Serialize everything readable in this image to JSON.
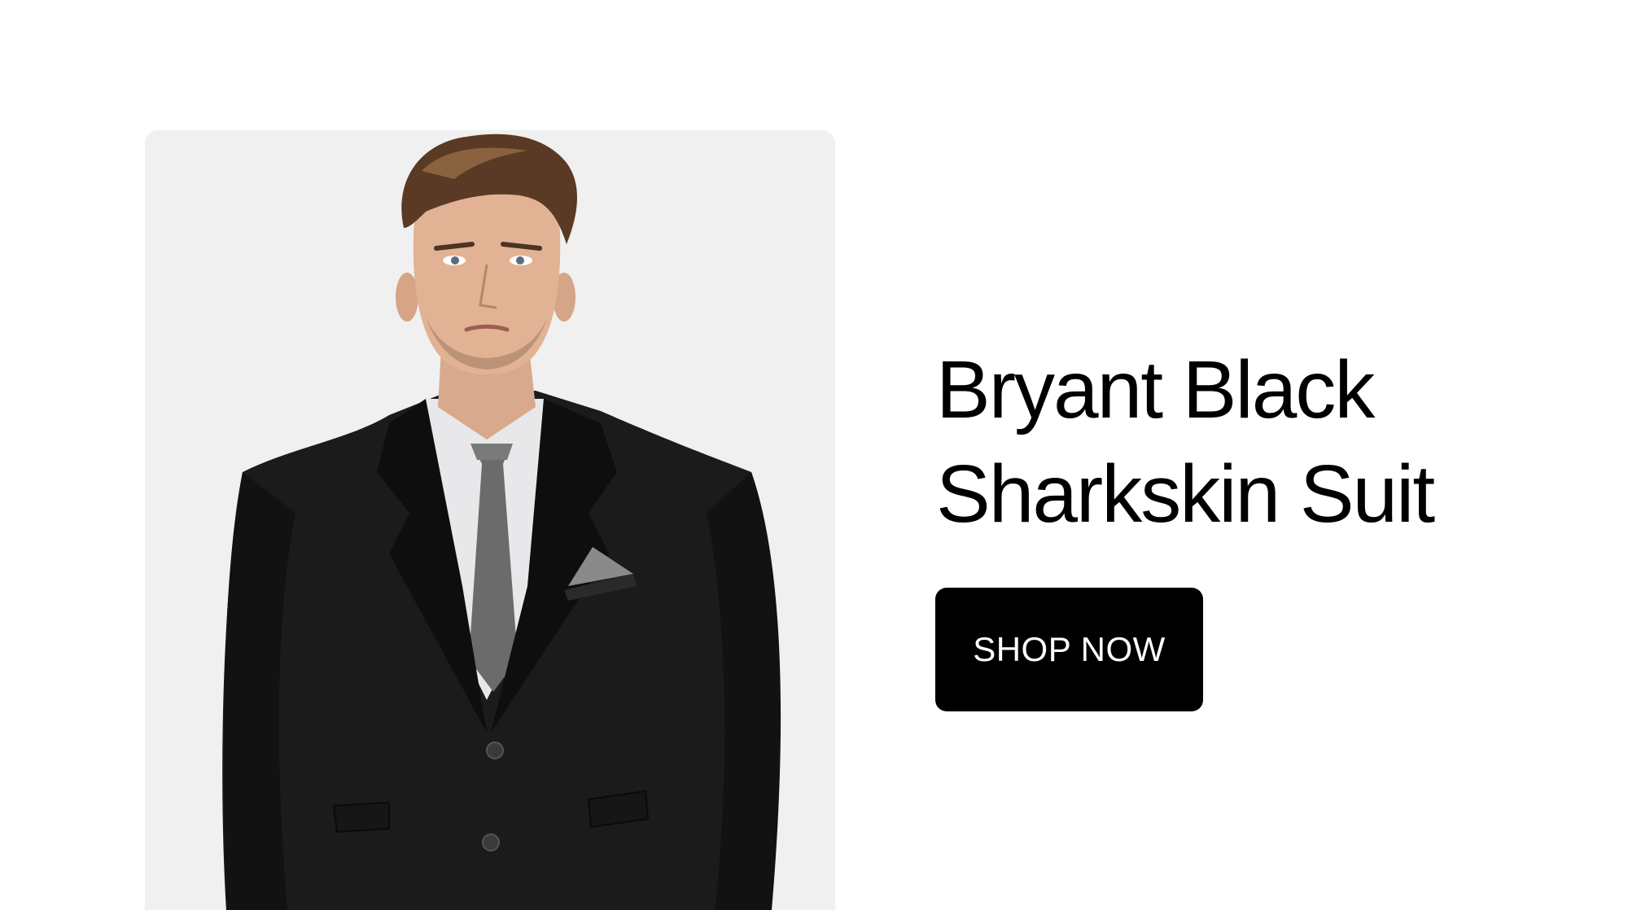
{
  "product": {
    "title_line1": "Bryant Black",
    "title_line2": "Sharkskin Suit",
    "cta_label": "SHOP NOW",
    "image_subject": "model-in-black-suit"
  },
  "colors": {
    "background": "#ffffff",
    "card_background": "#f0f0f0",
    "button_background": "#000000",
    "button_text": "#ffffff",
    "title_text": "#000000"
  }
}
